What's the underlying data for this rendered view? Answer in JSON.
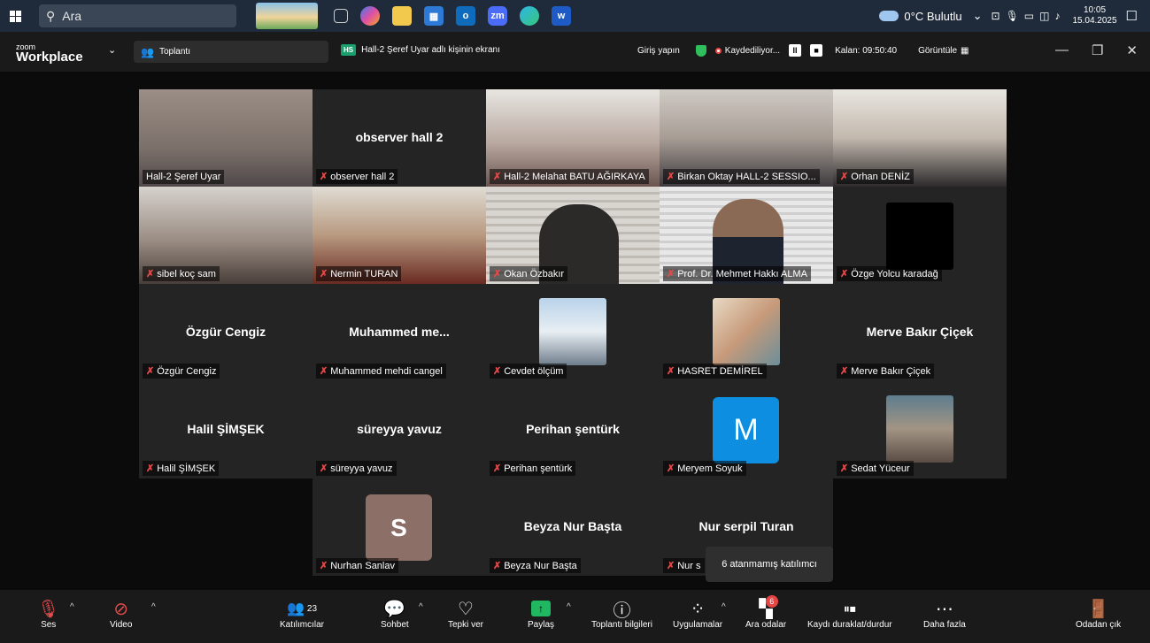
{
  "taskbar": {
    "search_label": "Ara",
    "weather": "0°C Bulutlu",
    "time": "10:05",
    "date": "15.04.2025"
  },
  "zoom": {
    "logo_small": "zoom",
    "logo_big": "Workplace",
    "meeting_label": "Toplantı",
    "share_badge": "HS",
    "share_title": "Hall-2 Şeref Uyar adlı kişinin ekranı",
    "signin": "Giriş yapın",
    "recording": "Kaydediliyor...",
    "remaining": "Kalan: 09:50:40",
    "view": "Görüntüle"
  },
  "tiles": [
    {
      "name": "Hall-2 Şeref Uyar",
      "center": "",
      "type": "video"
    },
    {
      "name": "observer hall 2",
      "center": "observer hall 2",
      "type": "name"
    },
    {
      "name": "Hall-2 Melahat BATU AĞIRKAYA",
      "center": "",
      "type": "video"
    },
    {
      "name": "Birkan Oktay HALL-2  SESSIO...",
      "center": "",
      "type": "video"
    },
    {
      "name": "Orhan DENİZ",
      "center": "",
      "type": "video"
    },
    {
      "name": "sibel koç sam",
      "center": "",
      "type": "video"
    },
    {
      "name": "Nermin TURAN",
      "center": "",
      "type": "video"
    },
    {
      "name": "Okan Özbakır",
      "center": "",
      "type": "video"
    },
    {
      "name": "Prof. Dr. Mehmet Hakkı ALMA",
      "center": "",
      "type": "video"
    },
    {
      "name": "Özge Yolcu karadağ",
      "center": "",
      "type": "black"
    },
    {
      "name": "Özgür Cengiz",
      "center": "Özgür Cengiz",
      "type": "name"
    },
    {
      "name": "Muhammed mehdi cangel",
      "center": "Muhammed  me...",
      "type": "name"
    },
    {
      "name": "Cevdet ölçüm",
      "center": "",
      "type": "photo"
    },
    {
      "name": "HASRET DEMİREL",
      "center": "",
      "type": "photo"
    },
    {
      "name": "Merve Bakır Çiçek",
      "center": "Merve Bakır Çiçek",
      "type": "name"
    },
    {
      "name": "Halil ŞİMŞEK",
      "center": "Halil ŞİMŞEK",
      "type": "name"
    },
    {
      "name": "süreyya yavuz",
      "center": "süreyya yavuz",
      "type": "name"
    },
    {
      "name": "Perihan şentürk",
      "center": "Perihan şentürk",
      "type": "name"
    },
    {
      "name": "Meryem Soyuk",
      "center": "M",
      "type": "initial"
    },
    {
      "name": "Sedat Yüceur",
      "center": "",
      "type": "photo"
    },
    {
      "name": "Nurhan Sanlav",
      "center": "S",
      "type": "initial"
    },
    {
      "name": "Beyza Nur Başta",
      "center": "Beyza Nur Başta",
      "type": "name"
    },
    {
      "name": "Nur s",
      "center": "Nur serpil Turan",
      "type": "name"
    }
  ],
  "tooltip": "6 atanmamış katılımcı",
  "toolbar": {
    "audio": "Ses",
    "video": "Video",
    "participants": "Katılımcılar",
    "participants_count": "23",
    "chat": "Sohbet",
    "react": "Tepki ver",
    "share": "Paylaş",
    "info": "Toplantı bilgileri",
    "apps": "Uygulamalar",
    "rooms": "Ara odalar",
    "rooms_badge": "6",
    "record": "Kaydı duraklat/durdur",
    "more": "Daha fazla",
    "leave": "Odadan çık"
  }
}
